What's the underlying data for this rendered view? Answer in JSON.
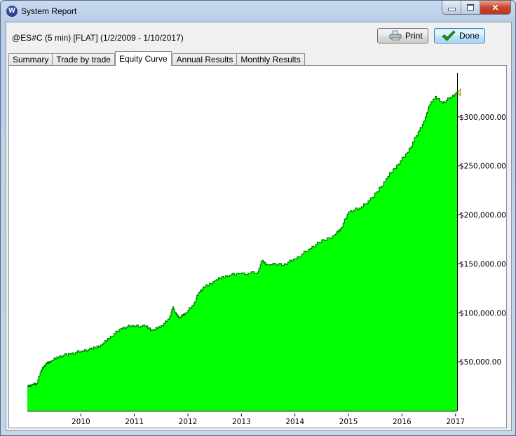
{
  "window": {
    "title": "System Report",
    "app_icon": "w-logo-icon",
    "controls": {
      "minimize": "minimize-icon",
      "maximize": "maximize-icon",
      "close": "close-icon"
    }
  },
  "header": {
    "report_label": "@ES#C (5 min) [FLAT]  (1/2/2009 - 1/10/2017)",
    "print_label": "Print",
    "print_icon": "printer-icon",
    "done_label": "Done",
    "done_icon": "checkmark-icon"
  },
  "tabs": [
    {
      "label": "Summary",
      "active": false
    },
    {
      "label": "Trade by trade",
      "active": false
    },
    {
      "label": "Equity Curve",
      "active": true
    },
    {
      "label": "Annual Results",
      "active": false
    },
    {
      "label": "Monthly Results",
      "active": false
    }
  ],
  "colors": {
    "fill": "#00ff00",
    "line": "#007a00",
    "marker": "#ffee00"
  },
  "chart_data": {
    "type": "area",
    "title": "",
    "xlabel": "",
    "ylabel": "",
    "x_range": [
      2009.0,
      2017.03
    ],
    "ylim": [
      0,
      345000
    ],
    "grid": false,
    "y_axis_side": "right",
    "x_ticks": [
      "2010",
      "2011",
      "2012",
      "2013",
      "2014",
      "2015",
      "2016",
      "2017"
    ],
    "x_tick_values": [
      2010,
      2011,
      2012,
      2013,
      2014,
      2015,
      2016,
      2017
    ],
    "y_ticks": [
      "$50,000.00",
      "$100,000.00",
      "$150,000.00",
      "$200,000.00",
      "$250,000.00",
      "$300,000.00"
    ],
    "y_tick_values": [
      50000,
      100000,
      150000,
      200000,
      250000,
      300000
    ],
    "end_marker": "yellow-triangle",
    "series": [
      {
        "name": "Equity",
        "x": [
          2009.0,
          2009.1,
          2009.17,
          2009.25,
          2009.3,
          2009.36,
          2009.45,
          2009.6,
          2009.8,
          2010.0,
          2010.2,
          2010.4,
          2010.55,
          2010.75,
          2010.95,
          2011.2,
          2011.35,
          2011.5,
          2011.65,
          2011.72,
          2011.78,
          2011.85,
          2011.95,
          2012.1,
          2012.2,
          2012.3,
          2012.5,
          2012.7,
          2012.95,
          2013.3,
          2013.38,
          2013.48,
          2013.8,
          2014.0,
          2014.25,
          2014.45,
          2014.75,
          2014.85,
          2015.0,
          2015.2,
          2015.45,
          2015.7,
          2015.9,
          2016.1,
          2016.3,
          2016.42,
          2016.5,
          2016.62,
          2016.75,
          2016.9,
          2017.03
        ],
        "values": [
          24600,
          27000,
          27500,
          40000,
          45000,
          48000,
          51000,
          56000,
          58000,
          61000,
          63000,
          68000,
          76000,
          84000,
          87000,
          86000,
          82000,
          87000,
          94000,
          106000,
          98000,
          95000,
          100000,
          108000,
          121000,
          126000,
          133000,
          138000,
          140000,
          141000,
          153000,
          149000,
          150000,
          155000,
          165000,
          172000,
          180000,
          186000,
          203000,
          207000,
          218000,
          237000,
          251000,
          264000,
          285000,
          296000,
          311000,
          321000,
          314000,
          320000,
          325000
        ]
      }
    ]
  }
}
